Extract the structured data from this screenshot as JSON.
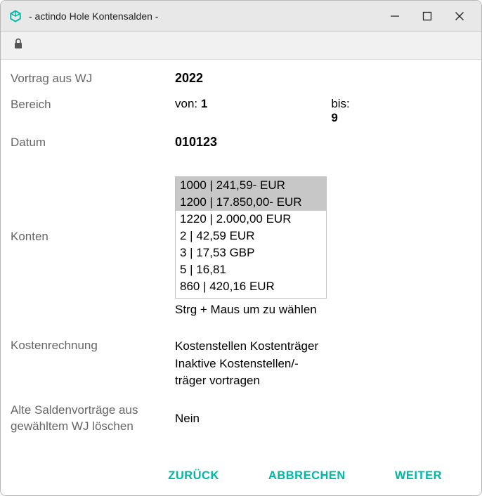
{
  "window": {
    "title": " - actindo Hole Kontensalden -"
  },
  "form": {
    "vortrag_label": "Vortrag aus WJ",
    "vortrag_value": "2022",
    "bereich_label": "Bereich",
    "bereich_von_prefix": "von: ",
    "bereich_von": "1",
    "bereich_bis_label": "bis:",
    "bereich_bis": "9",
    "datum_label": "Datum",
    "datum_value": "010123",
    "konten_label": "Konten",
    "accounts": [
      "1000 | 241,59- EUR",
      "1200 | 17.850,00- EUR",
      "1220 | 2.000,00 EUR",
      "2 | 42,59 EUR",
      "3 | 17,53 GBP",
      "5 | 16,81",
      "860 | 420,16 EUR"
    ],
    "hint": "Strg + Maus um zu wählen",
    "kost_label": "Kostenrechnung",
    "kost_value": "Kostenstellen Kostenträger Inaktive Kostenstellen/-träger vortragen",
    "delete_label": "Alte Saldenvorträge aus gewähltem WJ löschen",
    "delete_value": "Nein"
  },
  "buttons": {
    "back": "ZURÜCK",
    "cancel": "ABBRECHEN",
    "next": "WEITER"
  }
}
